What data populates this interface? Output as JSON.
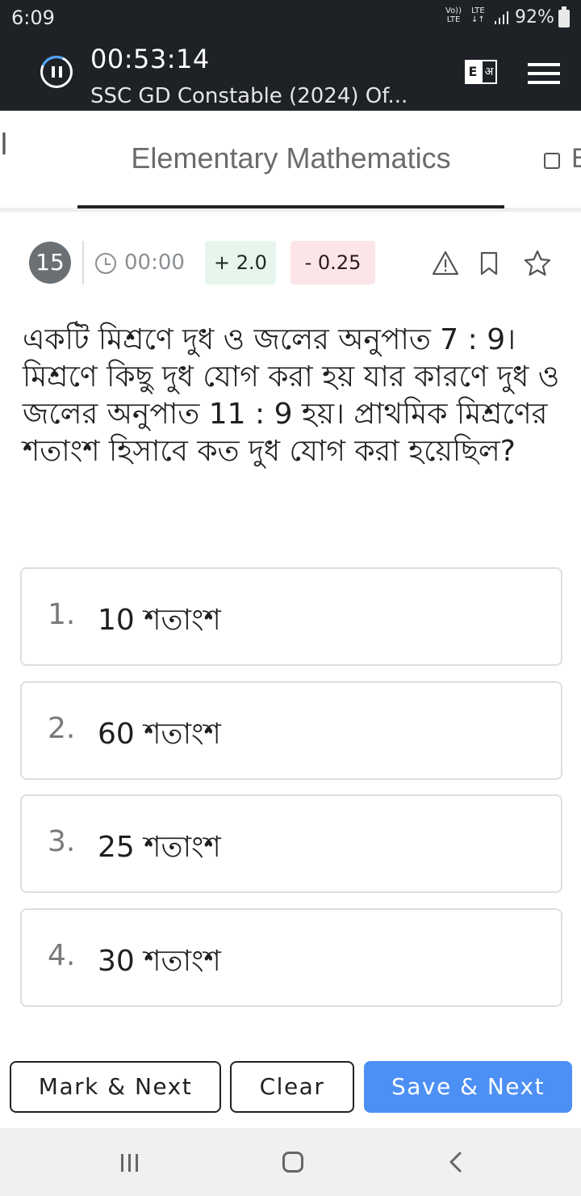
{
  "status_bar": {
    "time": "6:09",
    "network_1_top": "Vo))",
    "network_1_bottom": "LTE",
    "network_2_top": "LTE",
    "network_2_bottom": "↓↑",
    "battery": "92%"
  },
  "header": {
    "timer": "00:53:14",
    "exam_title": "SSC GD Constable (2024) Of...",
    "lang_en": "E",
    "lang_hi": "अ"
  },
  "tabs": {
    "left_partial": "l",
    "active": "Elementary Mathematics",
    "right_partial": "E"
  },
  "question_meta": {
    "number": "15",
    "time": "00:00",
    "positive_marks": "+ 2.0",
    "negative_marks": "- 0.25"
  },
  "question": {
    "text": "একটি মিশ্রণে দুধ ও জলের অনুপাত 7 : 9। মিশ্রণে কিছু দুধ যোগ করা হয় যার কারণে দুধ ও জলের অনুপাত 11 : 9 হয়। প্রাথমিক মিশ্রণের শতাংশ হিসাবে কত দুধ যোগ করা হয়েছিল?"
  },
  "options": [
    {
      "num": "1.",
      "text": "10 শতাংশ"
    },
    {
      "num": "2.",
      "text": "60 শতাংশ"
    },
    {
      "num": "3.",
      "text": "25 শতাংশ"
    },
    {
      "num": "4.",
      "text": "30 শতাংশ"
    }
  ],
  "buttons": {
    "mark_next": "Mark & Next",
    "clear": "Clear",
    "save_next": "Save & Next"
  },
  "colors": {
    "header_bg": "#1e2125",
    "accent": "#4c8ff5",
    "positive_bg": "#e6f6ec",
    "negative_bg": "#fbe5e8"
  },
  "icons": [
    "pause-icon",
    "language-toggle-icon",
    "menu-icon",
    "clock-icon",
    "report-icon",
    "bookmark-icon",
    "star-icon"
  ]
}
